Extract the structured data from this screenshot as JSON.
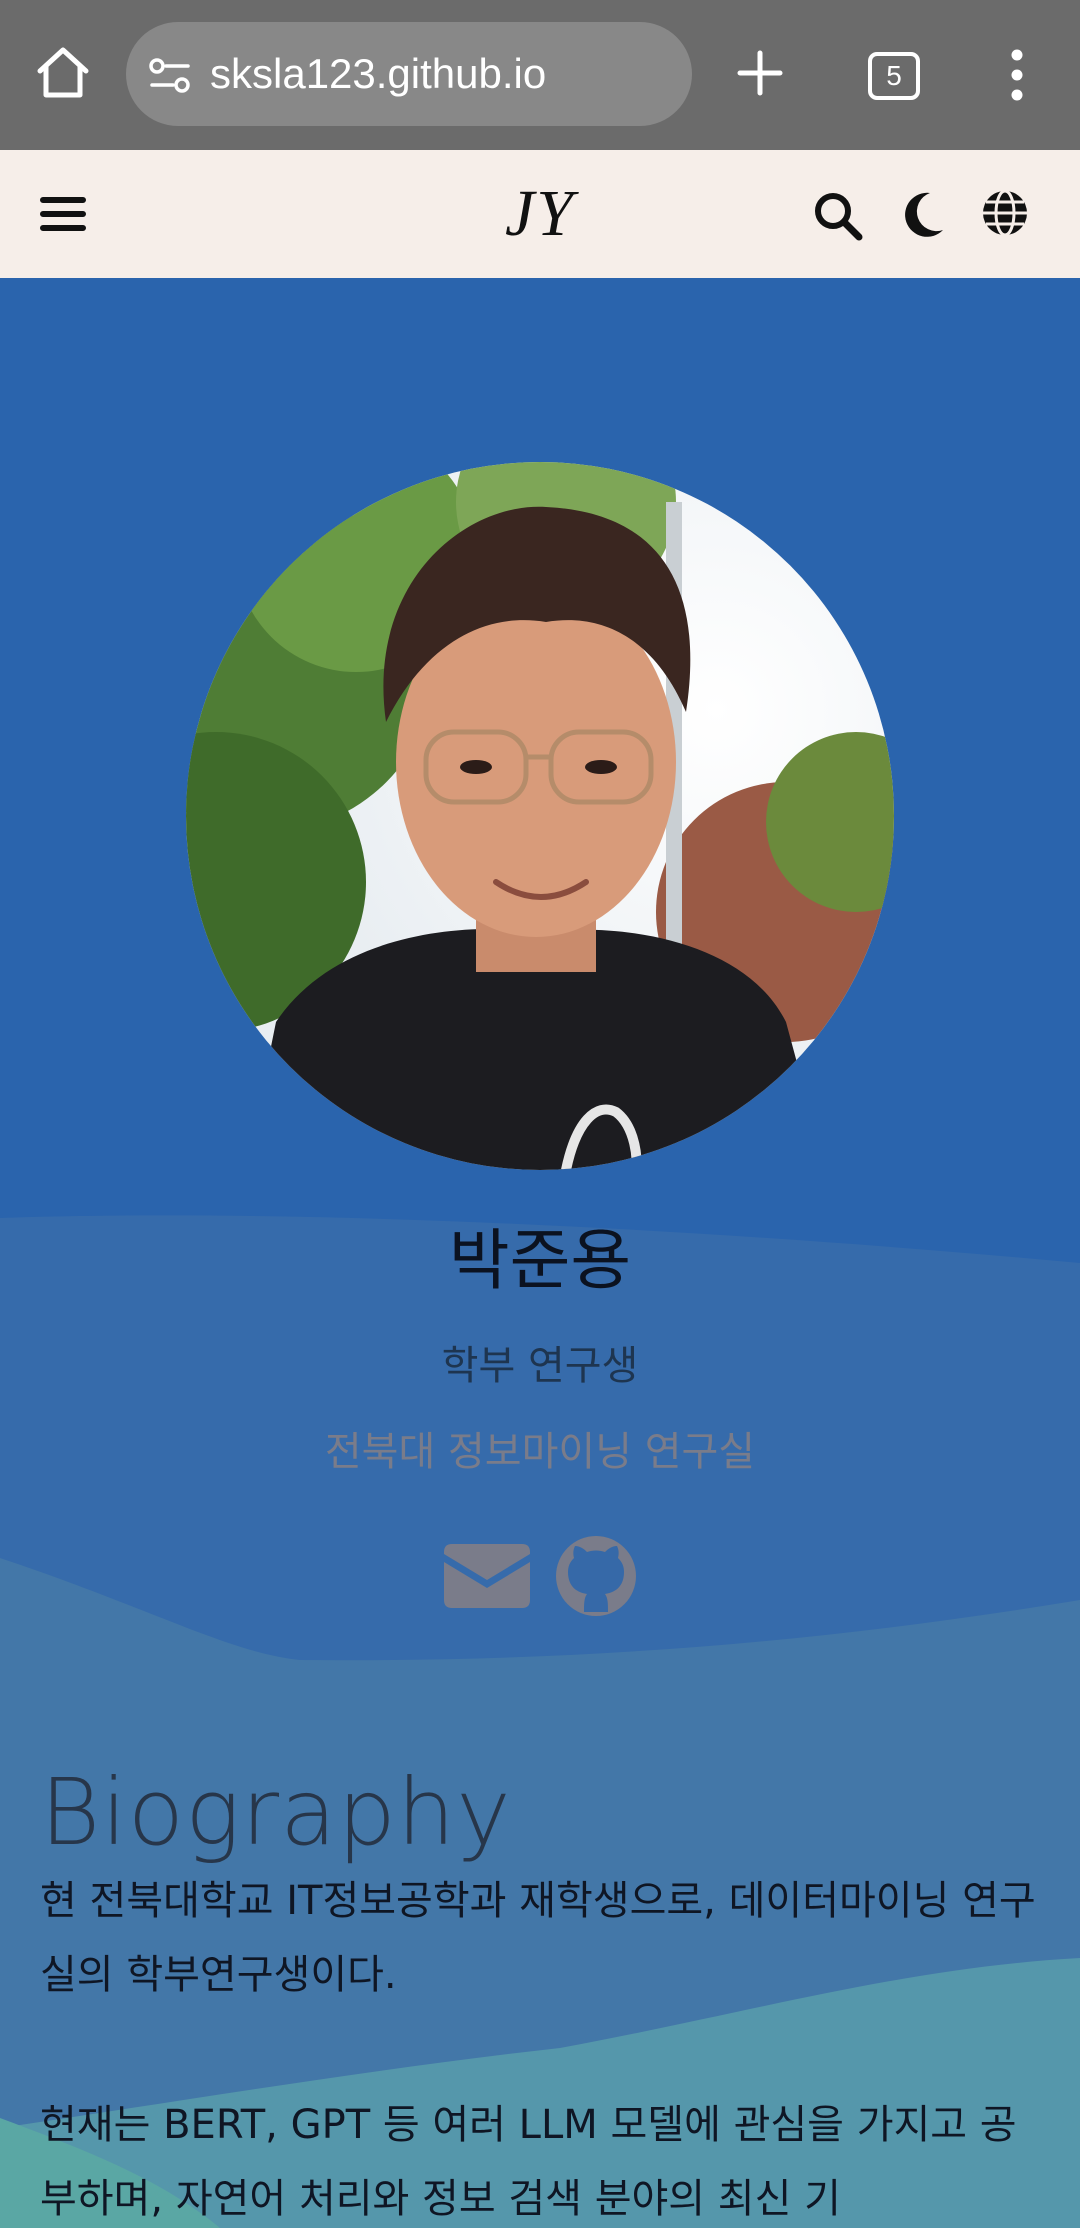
{
  "browser": {
    "url": "sksla123.github.io",
    "tab_count": "5",
    "icons": [
      "home-icon",
      "site-settings-icon",
      "new-tab-icon",
      "tab-switcher-icon",
      "more-options-icon"
    ]
  },
  "navbar": {
    "brand": "JY",
    "icons": [
      "hamburger-menu-icon",
      "search-icon",
      "moon-icon",
      "globe-icon"
    ]
  },
  "profile": {
    "name": "박준용",
    "role": "학부 연구생",
    "organization": "전북대 정보마이닝 연구실",
    "social_icons": [
      "envelope-icon",
      "github-icon"
    ]
  },
  "biography": {
    "title": "Biography",
    "paragraph1": "현 전북대학교 IT정보공학과 재학생으로, 데이터마이닝 연구실의 학부연구생이다.",
    "paragraph2": "현재는 BERT, GPT 등 여러 LLM 모델에 관심을 가지고 공부하며, 자연어 처리와 정보 검색 분야의 최신 기"
  },
  "colors": {
    "hero_blue": "#2a64ad",
    "navbar_bg": "#f6eee9",
    "browser_chrome": "#6b6b6b"
  }
}
